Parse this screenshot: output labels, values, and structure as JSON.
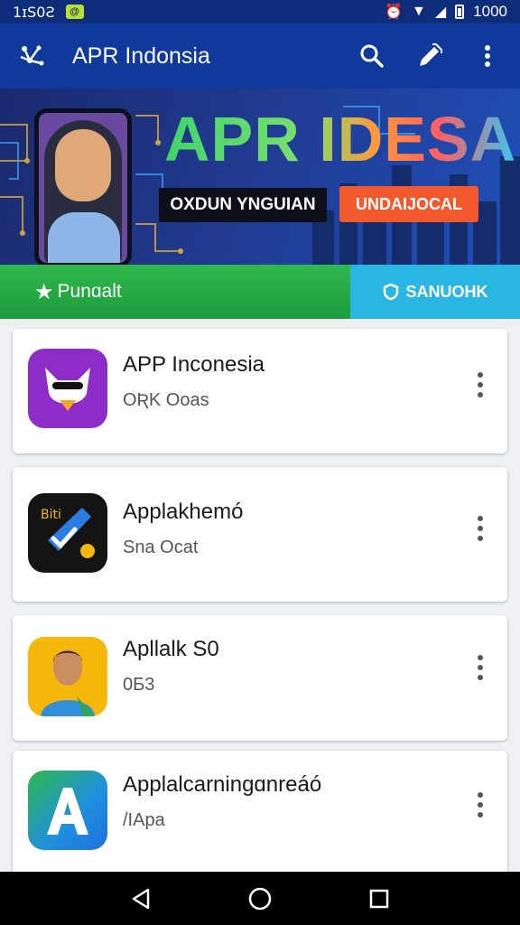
{
  "status_bar": {
    "time": "1ɪS0Ƨ",
    "battery_text": "1000"
  },
  "app_bar": {
    "title": "APR Indonsia"
  },
  "banner": {
    "headline": "APR IDESA",
    "tag_left": "OXDUN YNGUIAN",
    "tag_right": "UNDAIJOCAL"
  },
  "tabs": [
    {
      "label": "Punɑalt",
      "active": true
    },
    {
      "label": "SANUOHK",
      "active": false
    }
  ],
  "apps": [
    {
      "name": "APP Inconesia",
      "subtitle": "OƦK Ooas",
      "icon": "masked-cat-icon",
      "icon_bg": "#8e2cc8"
    },
    {
      "name": "Applakhemó",
      "subtitle": "Sna Ocat",
      "icon": "checkmark-guitar-icon",
      "icon_bg": "#141414"
    },
    {
      "name": "Apllalk S0",
      "subtitle": "0Ƃ3",
      "icon": "person-portrait-icon",
      "icon_bg": "#f5b70a"
    },
    {
      "name": "Applalcarningɑnreáó",
      "subtitle": "/IApa",
      "icon": "letter-a-icon",
      "icon_bg": "#1f8fe0"
    }
  ],
  "colors": {
    "status_bar": "#0d2d7a",
    "app_bar": "#0f3a9c",
    "featured_tab": "#2fb84d",
    "search_tab": "#29b6e3"
  }
}
